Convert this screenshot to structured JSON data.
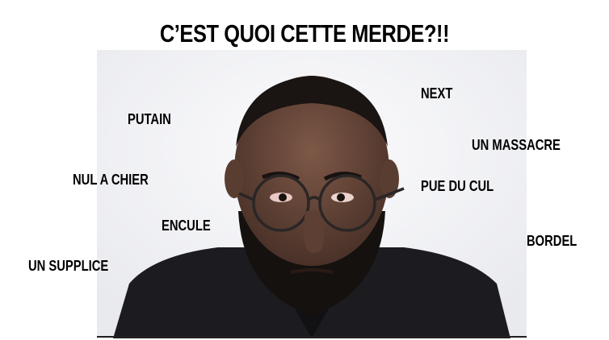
{
  "title": "C’EST QUOI CETTE MERDE?!!",
  "words": {
    "next": "NEXT",
    "putain": "PUTAIN",
    "un_massacre": "UN MASSACRE",
    "nul_a_chier": "NUL A CHIER",
    "pue_du_cul": "PUE DU CUL",
    "encule": "ENCULE",
    "bordel": "BORDEL",
    "un_supplice": "UN SUPPLICE"
  },
  "colors": {
    "text": "#000000",
    "background": "#ffffff",
    "jacket": "#1c1c20",
    "skin": "#6b4a3c"
  }
}
